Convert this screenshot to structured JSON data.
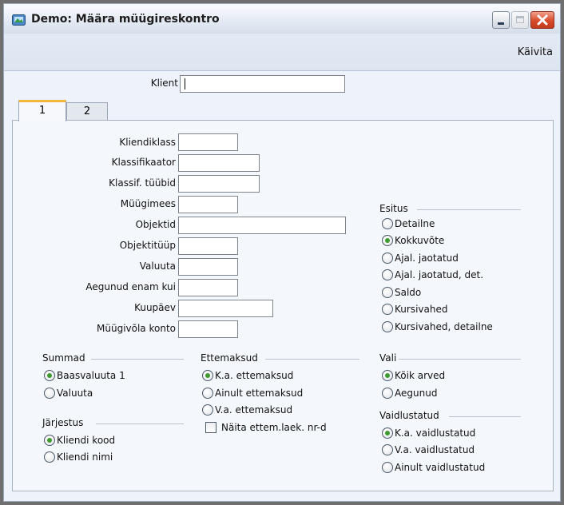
{
  "window": {
    "title": "Demo: Määra müügireskontro",
    "controls": {
      "minimize": "minimize-icon",
      "maximize": "maximize-icon",
      "close": "close-icon"
    }
  },
  "toolbar": {
    "run_label": "Käivita"
  },
  "client": {
    "label": "Klient",
    "value": ""
  },
  "tabs": [
    {
      "label": "1",
      "active": true
    },
    {
      "label": "2",
      "active": false
    }
  ],
  "fields": {
    "kliendiklass": {
      "label": "Kliendiklass",
      "value": ""
    },
    "klassifikaator": {
      "label": "Klassifikaator",
      "value": ""
    },
    "klassif_tyybid": {
      "label": "Klassif. tüübid",
      "value": ""
    },
    "myygimees": {
      "label": "Müügimees",
      "value": ""
    },
    "objektid": {
      "label": "Objektid",
      "value": ""
    },
    "objektityyp": {
      "label": "Objektitüüp",
      "value": ""
    },
    "valuuta": {
      "label": "Valuuta",
      "value": ""
    },
    "aegunud": {
      "label": "Aegunud enam kui",
      "value": ""
    },
    "kuupaev": {
      "label": "Kuupäev",
      "value": ""
    },
    "myygivola": {
      "label": "Müügivõla konto",
      "value": ""
    }
  },
  "esitus": {
    "title": "Esitus",
    "options": [
      "Detailne",
      "Kokkuvõte",
      "Ajal. jaotatud",
      "Ajal. jaotatud, det.",
      "Saldo",
      "Kursivahed",
      "Kursivahed, detailne"
    ],
    "selected": 1
  },
  "summad": {
    "title": "Summad",
    "options": [
      "Baasvaluuta 1",
      "Valuuta"
    ],
    "selected": 0
  },
  "jarjestus": {
    "title": "Järjestus",
    "options": [
      "Kliendi kood",
      "Kliendi nimi"
    ],
    "selected": 0
  },
  "ettemaksud": {
    "title": "Ettemaksud",
    "options": [
      "K.a. ettemaksud",
      "Ainult ettemaksud",
      "V.a. ettemaksud"
    ],
    "selected": 0,
    "checkbox": {
      "label": "Näita ettem.laek. nr-d",
      "checked": false
    }
  },
  "vali": {
    "title": "Vali",
    "options": [
      "Kõik arved",
      "Aegunud"
    ],
    "selected": 0
  },
  "vaidlustatud": {
    "title": "Vaidlustatud",
    "options": [
      "K.a. vaidlustatud",
      "V.a. vaidlustatud",
      "Ainult vaidlustatud"
    ],
    "selected": 0
  }
}
